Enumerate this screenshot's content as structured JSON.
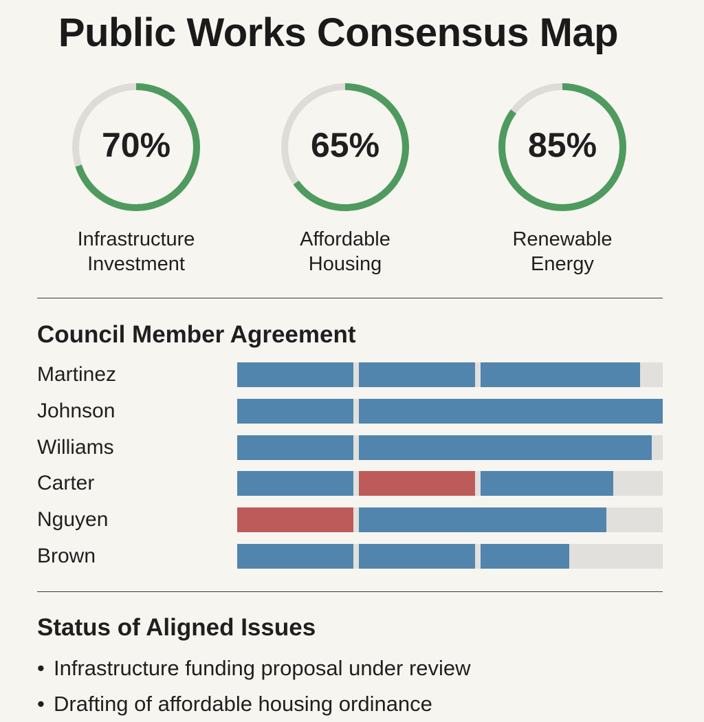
{
  "title": "Public Works Consensus Map",
  "colors": {
    "gauge_fill": "#4f9a5f",
    "gauge_track": "#dedcd8",
    "agree": "#5185ad",
    "disagree": "#bd5b5a",
    "empty": "#e1e0dc",
    "background": "#f7f5f0"
  },
  "gauges": [
    {
      "value": 70,
      "value_label": "70%",
      "label_lines": [
        "Infrastructure",
        "Investment"
      ]
    },
    {
      "value": 65,
      "value_label": "65%",
      "label_lines": [
        "Affordable",
        "Housing"
      ]
    },
    {
      "value": 85,
      "value_label": "85%",
      "label_lines": [
        "Renewable",
        "Energy"
      ]
    }
  ],
  "council": {
    "title": "Council Member Agreement",
    "scale_max": 100
  },
  "chart_data": {
    "type": "bar",
    "orientation": "horizontal",
    "stacked": true,
    "title": "Council Member Agreement",
    "categories": [
      "Martinez",
      "Johnson",
      "Williams",
      "Carter",
      "Nguyen",
      "Brown"
    ],
    "xlim": [
      0,
      100
    ],
    "members": [
      {
        "name": "Martinez",
        "segments": [
          {
            "value": 28.6,
            "stance": "agree"
          },
          {
            "value": 28.6,
            "stance": "agree"
          },
          {
            "value": 37.5,
            "stance": "agree"
          }
        ]
      },
      {
        "name": "Johnson",
        "segments": [
          {
            "value": 28.6,
            "stance": "agree"
          },
          {
            "value": 71.4,
            "stance": "agree"
          }
        ]
      },
      {
        "name": "Williams",
        "segments": [
          {
            "value": 28.6,
            "stance": "agree"
          },
          {
            "value": 68.8,
            "stance": "agree"
          }
        ]
      },
      {
        "name": "Carter",
        "segments": [
          {
            "value": 28.6,
            "stance": "agree"
          },
          {
            "value": 28.6,
            "stance": "disagree"
          },
          {
            "value": 31.2,
            "stance": "agree"
          }
        ]
      },
      {
        "name": "Nguyen",
        "segments": [
          {
            "value": 28.6,
            "stance": "disagree"
          },
          {
            "value": 58.1,
            "stance": "agree"
          }
        ]
      },
      {
        "name": "Brown",
        "segments": [
          {
            "value": 28.6,
            "stance": "agree"
          },
          {
            "value": 28.6,
            "stance": "agree"
          },
          {
            "value": 20.8,
            "stance": "agree"
          }
        ]
      }
    ]
  },
  "status": {
    "title": "Status of Aligned Issues",
    "bullet": "•",
    "items": [
      "Infrastructure funding proposal under review",
      "Drafting of affordable housing ordinance"
    ]
  }
}
